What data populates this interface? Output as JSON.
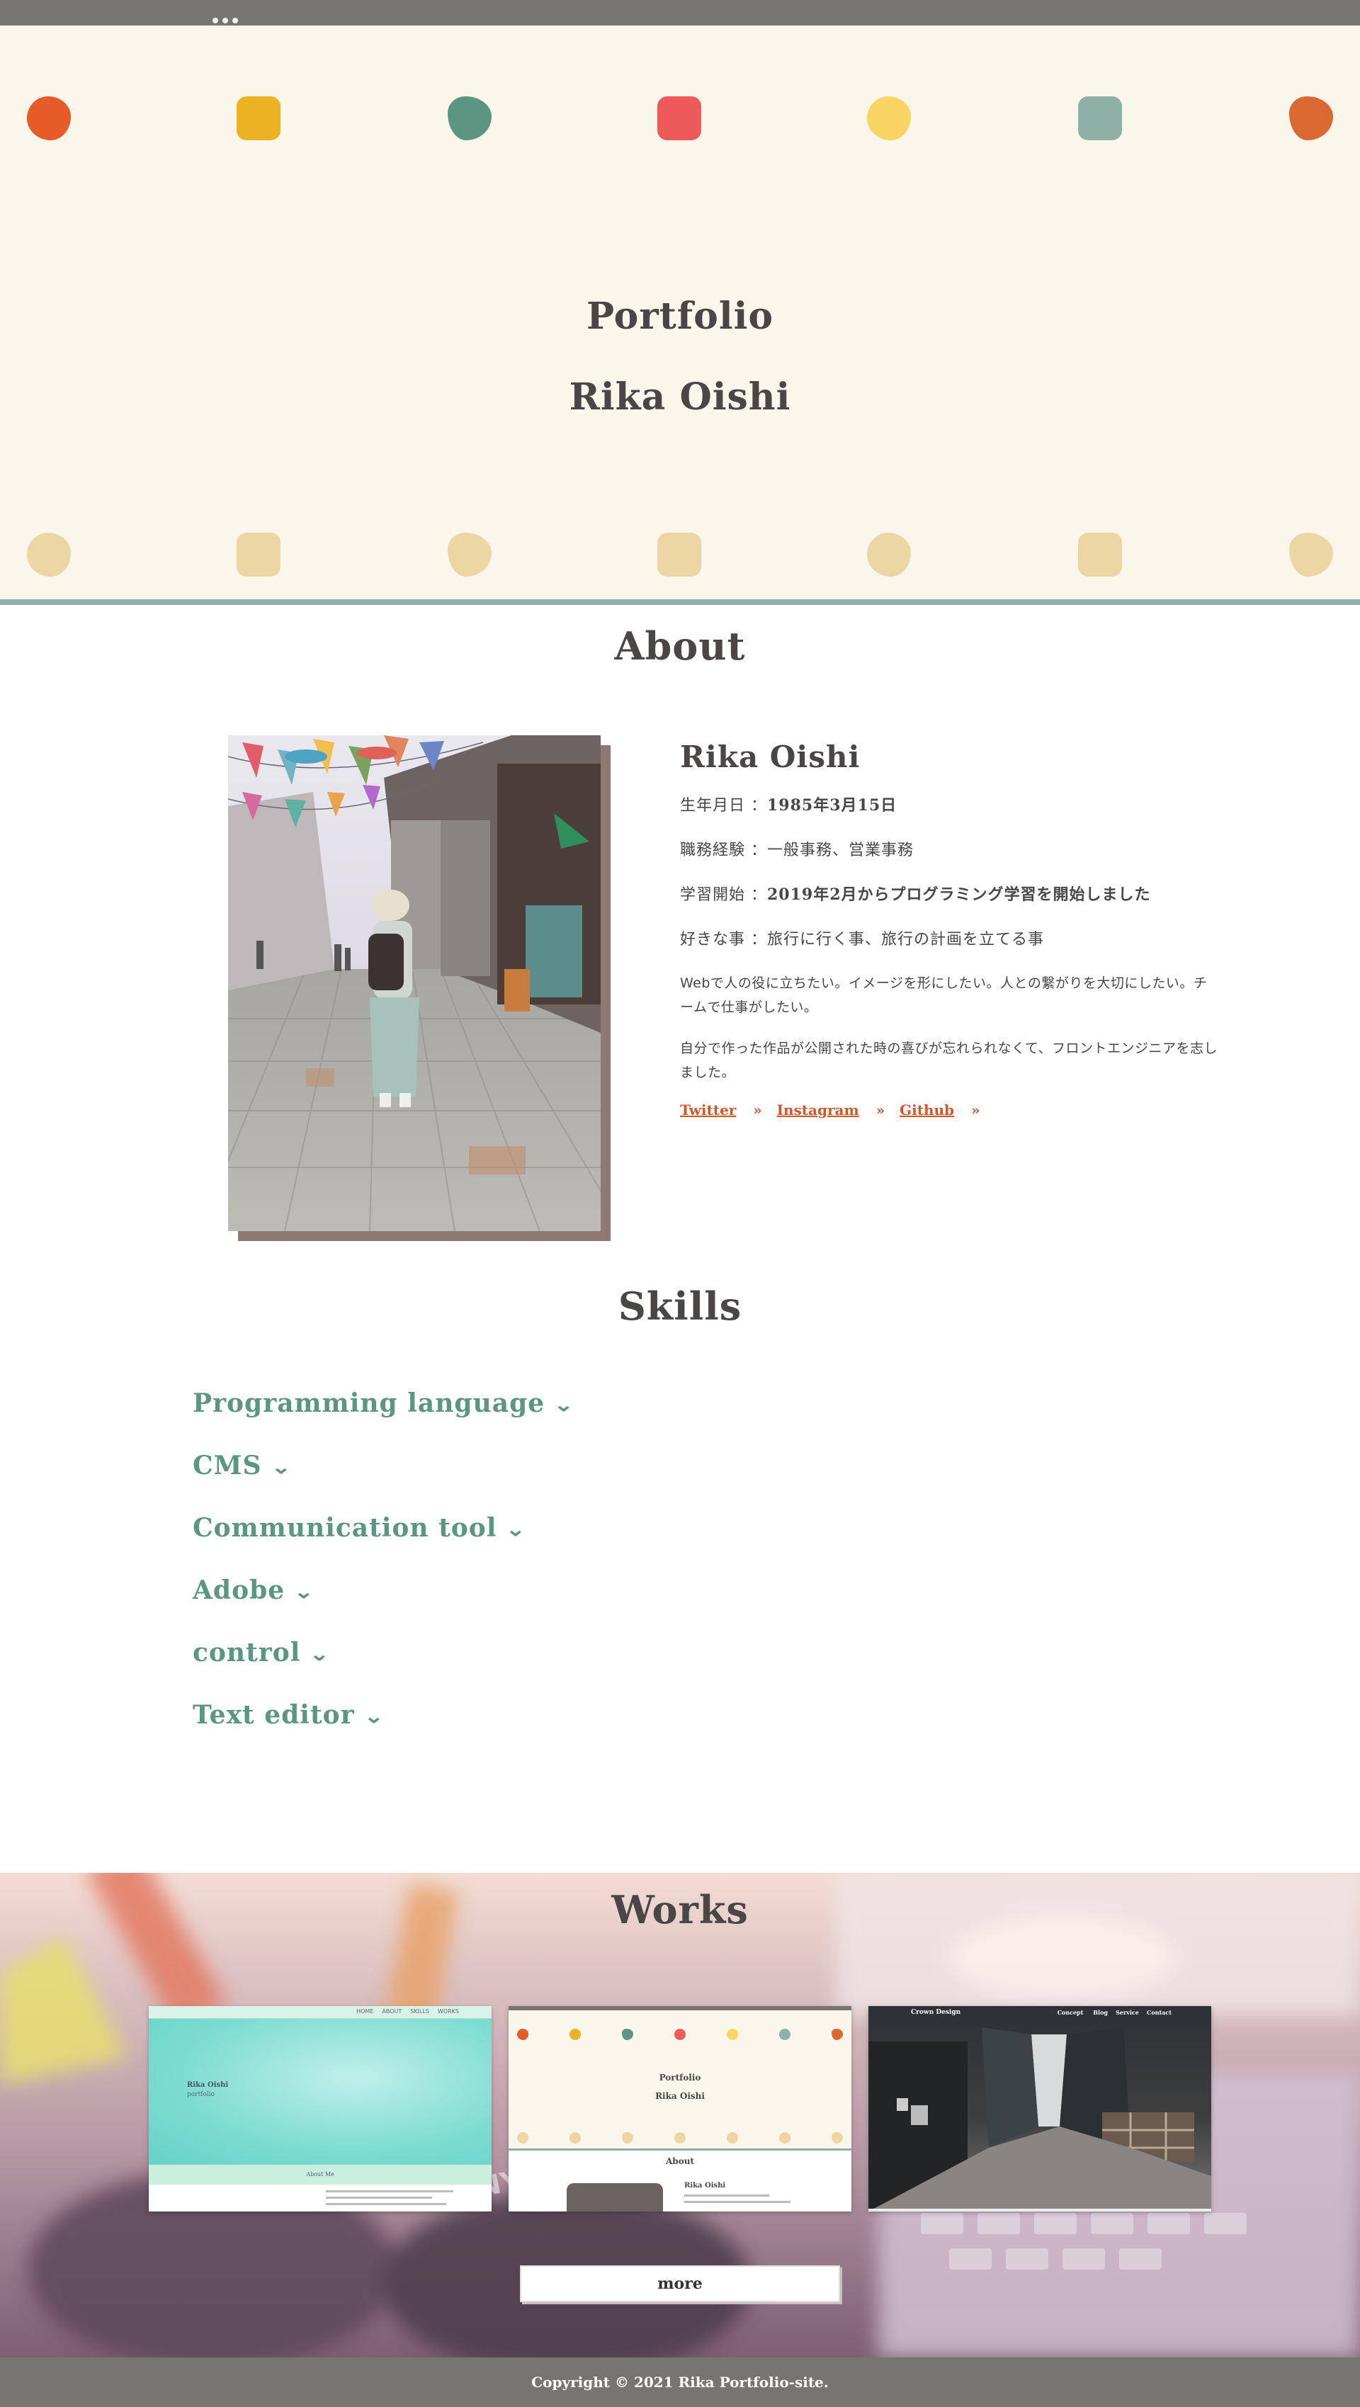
{
  "hero": {
    "title": "Portfolio",
    "subtitle": "Rika Oishi",
    "top_dot_colors": [
      "#e65b27",
      "#ebb224",
      "#5b9682",
      "#ee5a5a",
      "#fbd564",
      "#8fb0a7",
      "#d96930"
    ],
    "bottom_dot_color": "#ecd6a3"
  },
  "about": {
    "title": "About",
    "name": "Rika Oishi",
    "rows": [
      {
        "label": "生年月日 ：",
        "value": "1985年3月15日"
      },
      {
        "label": "職務経験 ：",
        "value": "一般事務、営業事務"
      },
      {
        "label": "学習開始 ：",
        "value": "2019年2月からプログラミング学習を開始しました"
      },
      {
        "label": "好きな事 ：",
        "value": "旅行に行く事、旅行の計画を立てる事"
      }
    ],
    "para1": "Webで人の役に立ちたい。イメージを形にしたい。人との繋がりを大切にしたい。チームで仕事がしたい。",
    "para2": "自分で作った作品が公開された時の喜びが忘れられなくて、フロントエンジニアを志しました。",
    "links": [
      {
        "label": "Twitter",
        "icon": "double-chevron-right-icon"
      },
      {
        "label": "Instagram",
        "icon": "double-chevron-right-icon"
      },
      {
        "label": "Github",
        "icon": "double-chevron-right-icon"
      }
    ],
    "link_color": "#d2582c"
  },
  "skills": {
    "title": "Skills",
    "items": [
      "Programming language",
      "CMS",
      "Communication tool",
      "Adobe",
      "control",
      "Text editor"
    ],
    "accent": "#5b9682"
  },
  "works": {
    "title": "Works",
    "more_label": "more",
    "card1": {
      "nav": [
        "HOME",
        "ABOUT",
        "SKILLS",
        "WORKS"
      ],
      "name": "Rika Oishi",
      "sub": "portfolio",
      "section": "About Me"
    },
    "card2": {
      "title": "Portfolio",
      "subtitle": "Rika Oishi",
      "section": "About",
      "name": "Rika Oishi"
    },
    "card3": {
      "brand": "Crown Design",
      "nav": [
        "Concept",
        "Blog",
        "Service",
        "Contact"
      ]
    }
  },
  "footer": {
    "copyright": "Copyright © 2021 Rika Portfolio-site."
  }
}
